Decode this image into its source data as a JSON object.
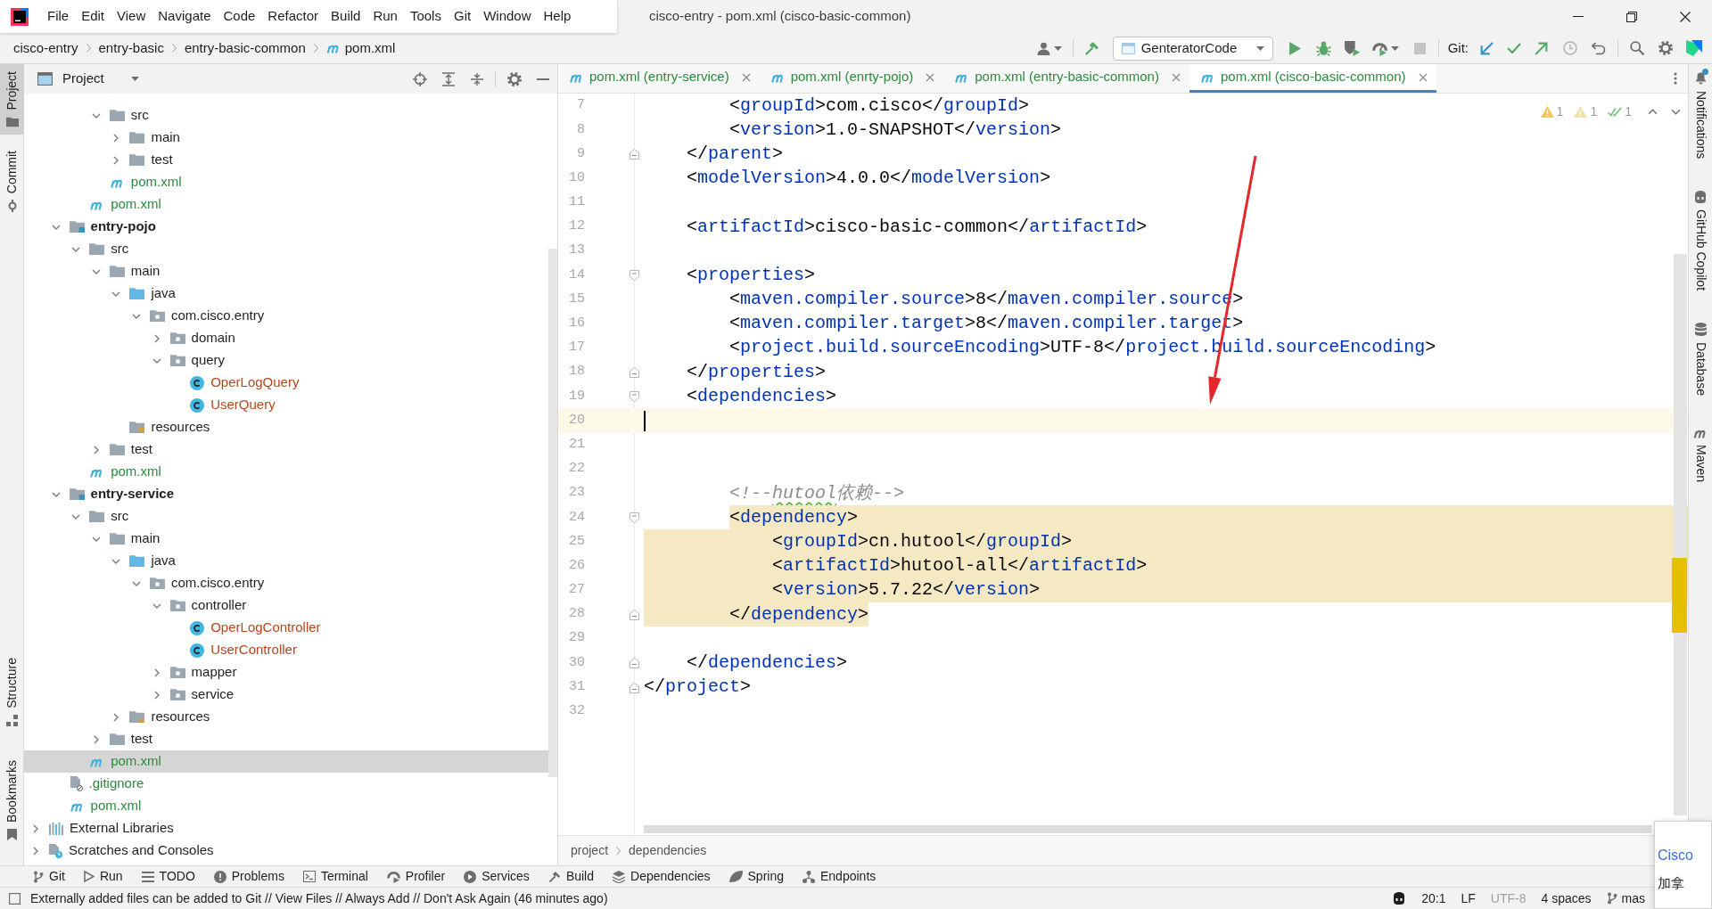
{
  "window": {
    "title": "cisco-entry - pom.xml (cisco-basic-common)"
  },
  "menu": [
    "File",
    "Edit",
    "View",
    "Navigate",
    "Code",
    "Refactor",
    "Build",
    "Run",
    "Tools",
    "Git",
    "Window",
    "Help"
  ],
  "navbar": {
    "crumbs": [
      {
        "label": "cisco-entry",
        "kind": "folder"
      },
      {
        "label": "entry-basic",
        "kind": "folder"
      },
      {
        "label": "entry-basic-common",
        "kind": "folder"
      },
      {
        "label": "pom.xml",
        "kind": "pom"
      }
    ]
  },
  "toolbar": {
    "run_config": "GenteratorCode",
    "git_label": "Git:"
  },
  "left_strip": {
    "top": [
      {
        "label": "Project",
        "kind": "folder",
        "selected": true
      },
      {
        "label": "Commit",
        "kind": "commit",
        "selected": false
      }
    ],
    "bottom": [
      {
        "label": "Structure",
        "kind": "structure",
        "selected": false
      },
      {
        "label": "Bookmarks",
        "kind": "bookmark",
        "selected": false
      }
    ]
  },
  "project_panel": {
    "title": "Project",
    "tree": [
      {
        "children": [
          {
            "children": [
              {
                "children": [
                  {
                    "label": "src",
                    "kind": "folder",
                    "color": "#1e1e1e",
                    "expanded": true,
                    "selected": false,
                    "children": [
                      {
                        "label": "main",
                        "kind": "folder",
                        "color": "#1e1e1e",
                        "expanded": false,
                        "selected": false
                      },
                      {
                        "label": "test",
                        "kind": "folder",
                        "color": "#1e1e1e",
                        "expanded": false,
                        "selected": false
                      }
                    ]
                  },
                  {
                    "label": "pom.xml",
                    "kind": "pom",
                    "color": "#2b8a3e",
                    "selected": false
                  }
                ]
              },
              {
                "label": "pom.xml",
                "kind": "pom",
                "color": "#2b8a3e",
                "selected": false
              }
            ]
          },
          {
            "label": "entry-pojo",
            "kind": "module",
            "color": "#1e1e1e",
            "expanded": true,
            "selected": false,
            "children": [
              {
                "label": "src",
                "kind": "folder",
                "color": "#1e1e1e",
                "expanded": true,
                "selected": false,
                "children": [
                  {
                    "label": "main",
                    "kind": "folder",
                    "color": "#1e1e1e",
                    "expanded": true,
                    "selected": false,
                    "children": [
                      {
                        "label": "java",
                        "kind": "source_folder",
                        "color": "#1e1e1e",
                        "expanded": true,
                        "selected": false,
                        "children": [
                          {
                            "label": "com.cisco.entry",
                            "kind": "package",
                            "color": "#1e1e1e",
                            "expanded": true,
                            "selected": false,
                            "children": [
                              {
                                "label": "domain",
                                "kind": "package",
                                "color": "#1e1e1e",
                                "expanded": false,
                                "selected": false
                              },
                              {
                                "label": "query",
                                "kind": "package",
                                "color": "#1e1e1e",
                                "expanded": true,
                                "selected": false,
                                "children": [
                                  {
                                    "label": "OperLogQuery",
                                    "kind": "class",
                                    "color": "#b4461b",
                                    "selected": false
                                  },
                                  {
                                    "label": "UserQuery",
                                    "kind": "class",
                                    "color": "#b4461b",
                                    "selected": false
                                  }
                                ]
                              }
                            ]
                          }
                        ]
                      },
                      {
                        "label": "resources",
                        "kind": "resources",
                        "color": "#1e1e1e",
                        "selected": false
                      }
                    ]
                  },
                  {
                    "label": "test",
                    "kind": "folder",
                    "color": "#1e1e1e",
                    "expanded": false,
                    "selected": false
                  }
                ]
              },
              {
                "label": "pom.xml",
                "kind": "pom",
                "color": "#2b8a3e",
                "selected": false
              }
            ]
          },
          {
            "label": "entry-service",
            "kind": "module",
            "color": "#1e1e1e",
            "expanded": true,
            "selected": false,
            "children": [
              {
                "label": "src",
                "kind": "folder",
                "color": "#1e1e1e",
                "expanded": true,
                "selected": false,
                "children": [
                  {
                    "label": "main",
                    "kind": "folder",
                    "color": "#1e1e1e",
                    "expanded": true,
                    "selected": false,
                    "children": [
                      {
                        "label": "java",
                        "kind": "source_folder",
                        "color": "#1e1e1e",
                        "expanded": true,
                        "selected": false,
                        "children": [
                          {
                            "label": "com.cisco.entry",
                            "kind": "package",
                            "color": "#1e1e1e",
                            "expanded": true,
                            "selected": false,
                            "children": [
                              {
                                "label": "controller",
                                "kind": "package",
                                "color": "#1e1e1e",
                                "expanded": true,
                                "selected": false,
                                "children": [
                                  {
                                    "label": "OperLogController",
                                    "kind": "class",
                                    "color": "#b4461b",
                                    "selected": false
                                  },
                                  {
                                    "label": "UserController",
                                    "kind": "class",
                                    "color": "#b4461b",
                                    "selected": false
                                  }
                                ]
                              },
                              {
                                "label": "mapper",
                                "kind": "package",
                                "color": "#1e1e1e",
                                "expanded": false,
                                "selected": false
                              },
                              {
                                "label": "service",
                                "kind": "package",
                                "color": "#1e1e1e",
                                "expanded": false,
                                "selected": false
                              }
                            ]
                          }
                        ]
                      },
                      {
                        "label": "resources",
                        "kind": "resources",
                        "color": "#1e1e1e",
                        "expanded": false,
                        "selected": false
                      }
                    ]
                  },
                  {
                    "label": "test",
                    "kind": "folder",
                    "color": "#1e1e1e",
                    "expanded": false,
                    "selected": false
                  }
                ]
              },
              {
                "label": "pom.xml",
                "kind": "pom",
                "color": "#2b8a3e",
                "selected": true
              }
            ]
          },
          {
            "label": ".gitignore",
            "kind": "gitignore",
            "color": "#2b8a3e",
            "selected": false
          },
          {
            "label": "pom.xml",
            "kind": "pom",
            "color": "#2b8a3e",
            "selected": false
          }
        ]
      },
      {
        "label": "External Libraries",
        "kind": "libraries",
        "color": "#1e1e1e",
        "expanded": false,
        "selected": false
      },
      {
        "label": "Scratches and Consoles",
        "kind": "scratches",
        "color": "#1e1e1e",
        "expanded": false,
        "selected": false
      }
    ]
  },
  "editor": {
    "tabs": [
      {
        "label": "pom.xml (entry-service)",
        "color": "#2b8a3e",
        "selected": false
      },
      {
        "label": "pom.xml (enrty-pojo)",
        "color": "#2b8a3e",
        "selected": false
      },
      {
        "label": "pom.xml (entry-basic-common)",
        "color": "#2b8a3e",
        "selected": false
      },
      {
        "label": "pom.xml (cisco-basic-common)",
        "color": "#2b8a3e",
        "selected": true
      }
    ],
    "inspections": [
      {
        "kind": "warning",
        "count": "1"
      },
      {
        "kind": "weak_warning",
        "count": "1"
      },
      {
        "kind": "typo",
        "count": "1"
      }
    ],
    "lines": [
      {
        "children": [
          {
            "children": [
              {
                "number": "7",
                "selected": false,
                "current": false,
                "tokens": [
                  {
                    "kind": "bracket",
                    "text": "<"
                  },
                  {
                    "kind": "tag",
                    "text": "groupId"
                  },
                  {
                    "kind": "bracket",
                    "text": ">"
                  },
                  {
                    "kind": "value",
                    "text": "com.cisco"
                  },
                  {
                    "kind": "bracket",
                    "text": "</"
                  },
                  {
                    "kind": "tag",
                    "text": "groupId"
                  },
                  {
                    "kind": "bracket",
                    "text": ">"
                  }
                ]
              },
              {
                "number": "8",
                "selected": false,
                "current": false,
                "tokens": [
                  {
                    "kind": "bracket",
                    "text": "<"
                  },
                  {
                    "kind": "tag",
                    "text": "version"
                  },
                  {
                    "kind": "bracket",
                    "text": ">"
                  },
                  {
                    "kind": "value",
                    "text": "1.0-SNAPSHOT"
                  },
                  {
                    "kind": "bracket",
                    "text": "</"
                  },
                  {
                    "kind": "tag",
                    "text": "version"
                  },
                  {
                    "kind": "bracket",
                    "text": ">"
                  }
                ]
              }
            ]
          },
          {
            "number": "9",
            "kind": "fold_end",
            "selected": false,
            "current": false,
            "tokens": [
              {
                "kind": "bracket",
                "text": "</"
              },
              {
                "kind": "tag",
                "text": "parent"
              },
              {
                "kind": "bracket",
                "text": ">"
              }
            ]
          },
          {
            "number": "10",
            "kind": "plain",
            "selected": false,
            "current": false,
            "tokens": [
              {
                "kind": "bracket",
                "text": "<"
              },
              {
                "kind": "tag",
                "text": "modelVersion"
              },
              {
                "kind": "bracket",
                "text": ">"
              },
              {
                "kind": "value",
                "text": "4.0.0"
              },
              {
                "kind": "bracket",
                "text": "</"
              },
              {
                "kind": "tag",
                "text": "modelVersion"
              },
              {
                "kind": "bracket",
                "text": ">"
              }
            ]
          },
          {
            "number": "11",
            "kind": "plain",
            "selected": false,
            "current": false
          },
          {
            "number": "12",
            "kind": "plain",
            "selected": false,
            "current": false,
            "tokens": [
              {
                "kind": "bracket",
                "text": "<"
              },
              {
                "kind": "tag",
                "text": "artifactId"
              },
              {
                "kind": "bracket",
                "text": ">"
              },
              {
                "kind": "value",
                "text": "cisco-basic-common"
              },
              {
                "kind": "bracket",
                "text": "</"
              },
              {
                "kind": "tag",
                "text": "artifactId"
              },
              {
                "kind": "bracket",
                "text": ">"
              }
            ]
          },
          {
            "number": "13",
            "kind": "plain",
            "selected": false,
            "current": false
          },
          {
            "number": "14",
            "kind": "fold_start",
            "selected": false,
            "current": false,
            "tokens": [
              {
                "kind": "bracket",
                "text": "<"
              },
              {
                "kind": "tag",
                "text": "properties"
              },
              {
                "kind": "bracket",
                "text": ">"
              }
            ],
            "children": [
              {
                "number": "15",
                "selected": false,
                "current": false,
                "tokens": [
                  {
                    "kind": "bracket",
                    "text": "<"
                  },
                  {
                    "kind": "tag",
                    "text": "maven.compiler.source"
                  },
                  {
                    "kind": "bracket",
                    "text": ">"
                  },
                  {
                    "kind": "value",
                    "text": "8"
                  },
                  {
                    "kind": "bracket",
                    "text": "</"
                  },
                  {
                    "kind": "tag",
                    "text": "maven.compiler.source"
                  },
                  {
                    "kind": "bracket",
                    "text": ">"
                  }
                ]
              },
              {
                "number": "16",
                "selected": false,
                "current": false,
                "tokens": [
                  {
                    "kind": "bracket",
                    "text": "<"
                  },
                  {
                    "kind": "tag",
                    "text": "maven.compiler.target"
                  },
                  {
                    "kind": "bracket",
                    "text": ">"
                  },
                  {
                    "kind": "value",
                    "text": "8"
                  },
                  {
                    "kind": "bracket",
                    "text": "</"
                  },
                  {
                    "kind": "tag",
                    "text": "maven.compiler.target"
                  },
                  {
                    "kind": "bracket",
                    "text": ">"
                  }
                ]
              },
              {
                "number": "17",
                "selected": false,
                "current": false,
                "tokens": [
                  {
                    "kind": "bracket",
                    "text": "<"
                  },
                  {
                    "kind": "tag",
                    "text": "project.build.sourceEncoding"
                  },
                  {
                    "kind": "bracket",
                    "text": ">"
                  },
                  {
                    "kind": "value",
                    "text": "UTF-8"
                  },
                  {
                    "kind": "bracket",
                    "text": "</"
                  },
                  {
                    "kind": "tag",
                    "text": "project.build.sourceEncoding"
                  },
                  {
                    "kind": "bracket",
                    "text": ">"
                  }
                ]
              }
            ]
          },
          {
            "number": "18",
            "kind": "fold_end",
            "selected": false,
            "current": false,
            "tokens": [
              {
                "kind": "bracket",
                "text": "</"
              },
              {
                "kind": "tag",
                "text": "properties"
              },
              {
                "kind": "bracket",
                "text": ">"
              }
            ]
          },
          {
            "number": "19",
            "kind": "fold_start",
            "selected": false,
            "current": false,
            "tokens": [
              {
                "kind": "bracket",
                "text": "<"
              },
              {
                "kind": "tag",
                "text": "dependencies"
              },
              {
                "kind": "bracket",
                "text": ">"
              }
            ],
            "children": [
              {
                "number": "20",
                "kind": "plain",
                "selected": false,
                "current": true
              },
              {
                "number": "21",
                "kind": "plain",
                "selected": false,
                "current": false
              },
              {
                "number": "22",
                "kind": "plain",
                "selected": false,
                "current": false
              },
              {
                "number": "23",
                "kind": "plain",
                "selected": false,
                "current": false,
                "tokens": [
                  {
                    "kind": "comment",
                    "text": "<!--"
                  },
                  {
                    "kind": "typo",
                    "text": "hutool"
                  },
                  {
                    "kind": "comment",
                    "text": "依赖-->"
                  }
                ]
              },
              {
                "number": "24",
                "kind": "fold_start",
                "selected": true,
                "current": false,
                "tokens": [
                  {
                    "kind": "bracket",
                    "text": "<"
                  },
                  {
                    "kind": "tag",
                    "text": "dependency"
                  },
                  {
                    "kind": "bracket",
                    "text": ">"
                  }
                ],
                "children": [
                  {
                    "number": "25",
                    "selected": true,
                    "current": false,
                    "tokens": [
                      {
                        "kind": "bracket",
                        "text": "<"
                      },
                      {
                        "kind": "tag",
                        "text": "groupId"
                      },
                      {
                        "kind": "bracket",
                        "text": ">"
                      },
                      {
                        "kind": "value",
                        "text": "cn.hutool"
                      },
                      {
                        "kind": "bracket",
                        "text": "</"
                      },
                      {
                        "kind": "tag",
                        "text": "groupId"
                      },
                      {
                        "kind": "bracket",
                        "text": ">"
                      }
                    ]
                  },
                  {
                    "number": "26",
                    "selected": true,
                    "current": false,
                    "tokens": [
                      {
                        "kind": "bracket",
                        "text": "<"
                      },
                      {
                        "kind": "tag",
                        "text": "artifactId"
                      },
                      {
                        "kind": "bracket",
                        "text": ">"
                      },
                      {
                        "kind": "value",
                        "text": "hutool-all"
                      },
                      {
                        "kind": "bracket",
                        "text": "</"
                      },
                      {
                        "kind": "tag",
                        "text": "artifactId"
                      },
                      {
                        "kind": "bracket",
                        "text": ">"
                      }
                    ]
                  },
                  {
                    "number": "27",
                    "selected": true,
                    "current": false,
                    "tokens": [
                      {
                        "kind": "bracket",
                        "text": "<"
                      },
                      {
                        "kind": "tag",
                        "text": "version"
                      },
                      {
                        "kind": "bracket",
                        "text": ">"
                      },
                      {
                        "kind": "value",
                        "text": "5.7.22"
                      },
                      {
                        "kind": "bracket",
                        "text": "</"
                      },
                      {
                        "kind": "tag",
                        "text": "version"
                      },
                      {
                        "kind": "bracket",
                        "text": ">"
                      }
                    ]
                  }
                ]
              },
              {
                "number": "28",
                "kind": "fold_end",
                "selected": true,
                "current": false,
                "tokens": [
                  {
                    "kind": "bracket",
                    "text": "</"
                  },
                  {
                    "kind": "tag",
                    "text": "dependency"
                  },
                  {
                    "kind": "bracket",
                    "text": ">"
                  }
                ]
              },
              {
                "number": "29",
                "kind": "plain",
                "selected": false,
                "current": false
              }
            ]
          },
          {
            "number": "30",
            "kind": "fold_end",
            "selected": false,
            "current": false,
            "tokens": [
              {
                "kind": "bracket",
                "text": "</"
              },
              {
                "kind": "tag",
                "text": "dependencies"
              },
              {
                "kind": "bracket",
                "text": ">"
              }
            ]
          }
        ]
      },
      {
        "number": "31",
        "kind": "fold_end",
        "selected": false,
        "current": false,
        "tokens": [
          {
            "kind": "bracket",
            "text": "</"
          },
          {
            "kind": "tag",
            "text": "project"
          },
          {
            "kind": "bracket",
            "text": ">"
          }
        ]
      },
      {
        "number": "32",
        "kind": "plain",
        "selected": false,
        "current": false
      }
    ],
    "breadcrumbs": [
      "project",
      "dependencies"
    ]
  },
  "right_strip": [
    {
      "label": "Notifications",
      "kind": "bell",
      "badge": true
    },
    {
      "label": "GitHub Copilot",
      "kind": "copilot",
      "badge": false
    },
    {
      "label": "Database",
      "kind": "database",
      "badge": false
    },
    {
      "label": "Maven",
      "kind": "maven",
      "badge": false
    }
  ],
  "bottom_tools": [
    {
      "label": "Git",
      "kind": "branch"
    },
    {
      "label": "Run",
      "kind": "play"
    },
    {
      "label": "TODO",
      "kind": "list"
    },
    {
      "label": "Problems",
      "kind": "problems"
    },
    {
      "label": "Terminal",
      "kind": "terminal"
    },
    {
      "label": "Profiler",
      "kind": "gauge"
    },
    {
      "label": "Services",
      "kind": "services"
    },
    {
      "label": "Build",
      "kind": "hammer"
    },
    {
      "label": "Dependencies",
      "kind": "stack"
    },
    {
      "label": "Spring",
      "kind": "leaf"
    },
    {
      "label": "Endpoints",
      "kind": "endpoints"
    }
  ],
  "status_bar": {
    "message": "Externally added files can be added to Git // View Files // Always Add // Don't Ask Again (46 minutes ago)",
    "widgets": [
      {
        "kind": "copilot",
        "disabled": false
      },
      {
        "kind": "text",
        "text": "20:1",
        "disabled": false
      },
      {
        "kind": "text",
        "text": "LF",
        "disabled": false
      },
      {
        "kind": "text",
        "text": "UTF-8",
        "disabled": true
      },
      {
        "kind": "text",
        "text": "4 spaces",
        "disabled": false
      },
      {
        "kind": "branch",
        "text": "mas",
        "disabled": false
      }
    ]
  },
  "notification": {
    "title": "Cisco",
    "body": "加拿"
  },
  "markup": [
    {
      "kind": "arrow"
    }
  ]
}
